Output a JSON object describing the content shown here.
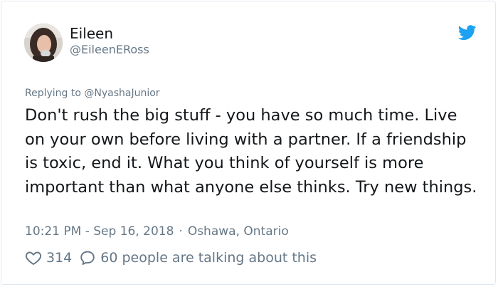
{
  "author": {
    "display_name": "Eileen",
    "handle": "@EileenERoss"
  },
  "tweet": {
    "reply_prefix": "Replying to",
    "reply_to": "@NyashaJunior",
    "text": "Don't rush the big stuff - you have so much time. Live on your own before living with a partner. If a friendship is toxic, end it. What you think of yourself is more important than what anyone else thinks. Try new things.",
    "time": "10:21 PM - Sep 16, 2018",
    "location": "Oshawa, Ontario"
  },
  "stats": {
    "likes": "314",
    "talking": "60 people are talking about this"
  },
  "colors": {
    "brand_blue": "#1da1f2",
    "secondary_text": "#657786",
    "primary_text": "#14171a",
    "border": "#e1e8ed"
  },
  "icons": {
    "brand": "twitter-bird-icon",
    "like": "heart-icon",
    "reply": "speech-bubble-icon"
  }
}
